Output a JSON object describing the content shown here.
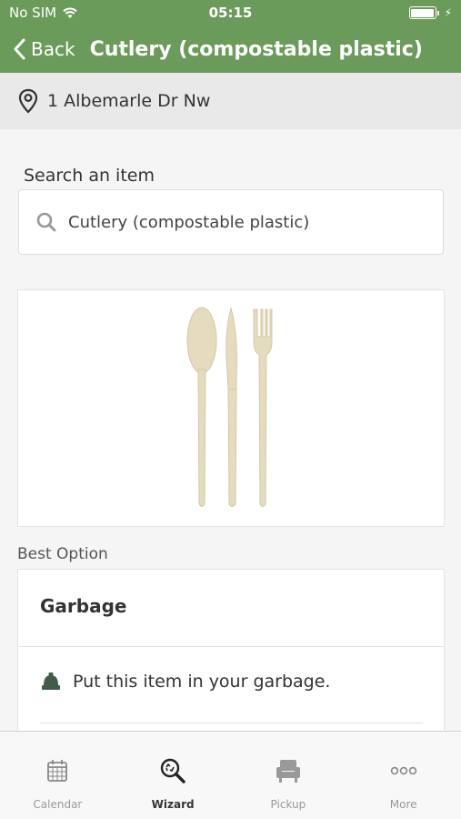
{
  "status_bar": {
    "carrier": "No SIM",
    "time": "05:15"
  },
  "nav": {
    "back_label": "Back",
    "title": "Cutlery (compostable plastic)"
  },
  "address": {
    "text": "1 Albemarle Dr Nw",
    "icon": "location-pin-icon"
  },
  "search": {
    "heading": "Search an item",
    "value": "Cutlery (compostable plastic)",
    "icon": "search-icon"
  },
  "item_image": {
    "depicts": "compostable plastic cutlery"
  },
  "best_option": {
    "label": "Best Option",
    "title": "Garbage",
    "instruction": "Put this item in your garbage.",
    "icon": "garbage-bin-icon"
  },
  "tabs": [
    {
      "label": "Calendar",
      "icon": "calendar-icon",
      "active": false
    },
    {
      "label": "Wizard",
      "icon": "wizard-search-icon",
      "active": true
    },
    {
      "label": "Pickup",
      "icon": "armchair-icon",
      "active": false
    },
    {
      "label": "More",
      "icon": "more-icon",
      "active": false
    }
  ],
  "colors": {
    "header_green": "#6a9b5a",
    "garbage_icon": "#3f5d48"
  }
}
